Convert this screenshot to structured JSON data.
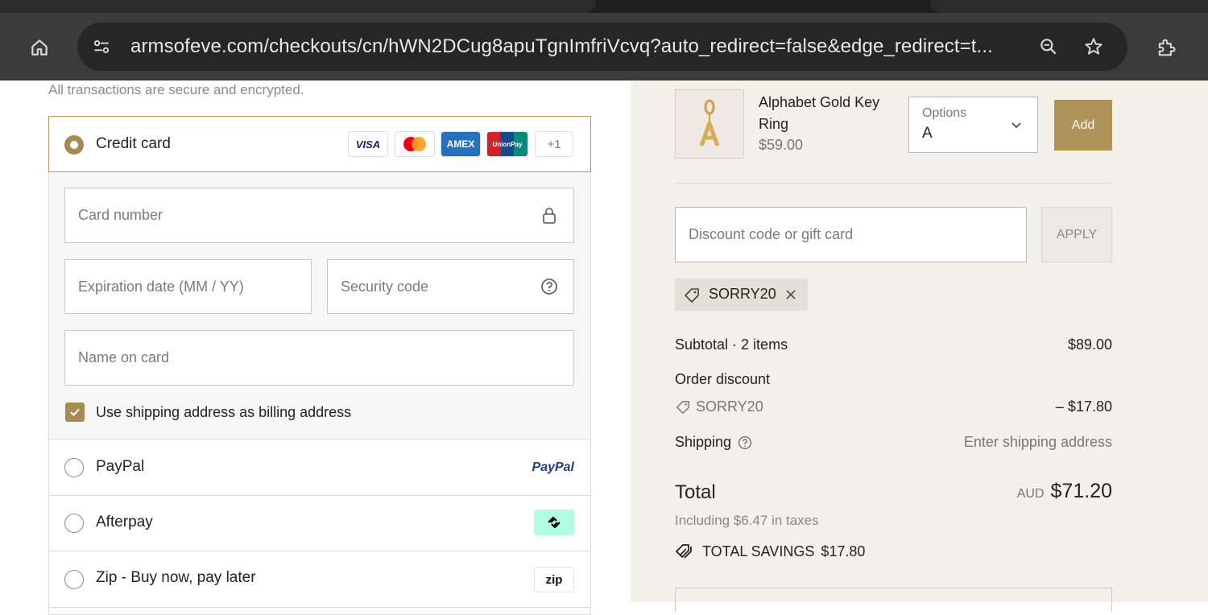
{
  "browser": {
    "url": "armsofeve.com/checkouts/cn/hWN2DCug8apuTgnImfriVcvq?auto_redirect=false&edge_redirect=t..."
  },
  "payment": {
    "secure_note": "All transactions are secure and encrypted.",
    "credit_card": {
      "label": "Credit card",
      "logos": [
        "VISA",
        "Mastercard",
        "AMEX",
        "UnionPay",
        "+1"
      ],
      "card_number_placeholder": "Card number",
      "expiration_placeholder": "Expiration date (MM / YY)",
      "security_placeholder": "Security code",
      "name_placeholder": "Name on card",
      "billing_checkbox_label": "Use shipping address as billing address"
    },
    "methods": [
      {
        "label": "PayPal",
        "logo_text": "PayPal"
      },
      {
        "label": "Afterpay"
      },
      {
        "label": "Zip - Buy now, pay later",
        "logo_text": "zip"
      }
    ]
  },
  "cart": {
    "product": {
      "name": "Alphabet Gold Key Ring",
      "price": "$59.00",
      "options_label": "Options",
      "options_value": "A",
      "add_label": "Add"
    },
    "discount": {
      "placeholder": "Discount code or gift card",
      "apply_label": "APPLY",
      "applied_code": "SORRY20"
    },
    "summary": {
      "subtotal_label": "Subtotal · 2 items",
      "subtotal_value": "$89.00",
      "order_discount_label": "Order discount",
      "discount_code": "SORRY20",
      "discount_value": "– $17.80",
      "shipping_label": "Shipping",
      "shipping_value": "Enter shipping address",
      "total_label": "Total",
      "currency": "AUD",
      "total_value": "$71.20",
      "taxes_note": "Including $6.47 in taxes",
      "savings_label": "TOTAL SAVINGS",
      "savings_value": "$17.80"
    }
  },
  "colors": {
    "accent": "#a58a52",
    "add_button": "#b09358",
    "right_panel_bg": "#f3f0ea",
    "toolbar_bg": "#3b3b3b"
  }
}
